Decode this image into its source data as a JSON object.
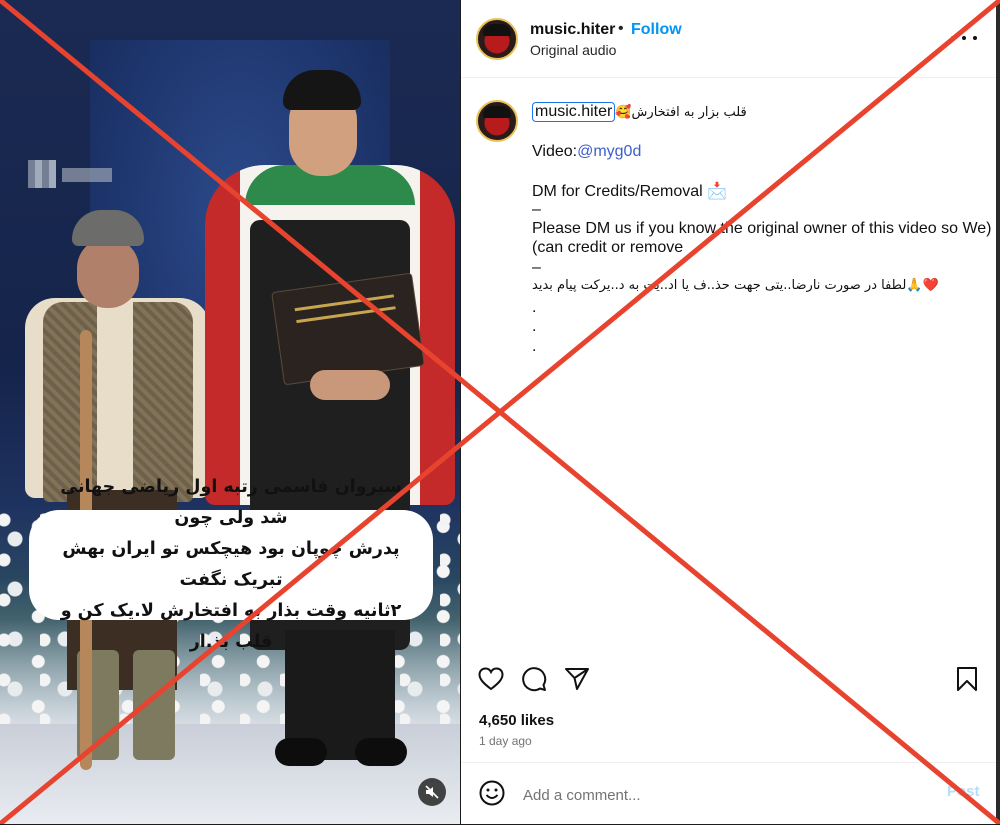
{
  "media": {
    "caption_lines": [
      "سیروان قاسمی رتبه اول ریاضی جهانی شد ولی چون",
      "پدرش چوپان بود هیچکس تو ایران بهش تبریک نگفت",
      "۲ثانیه وقت بذار به افتخارش لا.یک کن و قلب بذ.ار"
    ],
    "mute_icon": "speaker-muted-icon"
  },
  "header": {
    "username": "music.hiter",
    "separator": "•",
    "follow_label": "Follow",
    "subtitle": "Original audio",
    "more_icon": "more-options-icon"
  },
  "caption": {
    "username": "music.hiter",
    "title_text": "🥰قلب بزار به افتخارش",
    "video_prefix": "Video:",
    "video_handle": "@myg0d",
    "dm_line": "DM for Credits/Removal 📩",
    "dash1": "–",
    "notice_line1": "Please DM us if you know the original owner of this video so We)",
    "notice_line2": "(can credit or remove",
    "dash2": "–",
    "persian_notice": "لطفا در صورت نارضا..یتی جهت حذ..ف یا اد..یت به د..یرکت پیام بدید🙏❤️",
    "dots": [
      ".",
      ".",
      "."
    ]
  },
  "actions": {
    "like_icon": "heart-icon",
    "comment_icon": "comment-icon",
    "share_icon": "share-icon",
    "save_icon": "bookmark-icon"
  },
  "stats": {
    "likes": "4,650 likes",
    "time_ago": "1 day ago"
  },
  "comment": {
    "emoji_icon": "emoji-icon",
    "placeholder": "Add a comment...",
    "post_label": "Post"
  },
  "colors": {
    "follow": "#0095f6",
    "link": "#3a5fcf",
    "overlay_x": "#e8432f",
    "post_disabled": "#b2dffc"
  }
}
